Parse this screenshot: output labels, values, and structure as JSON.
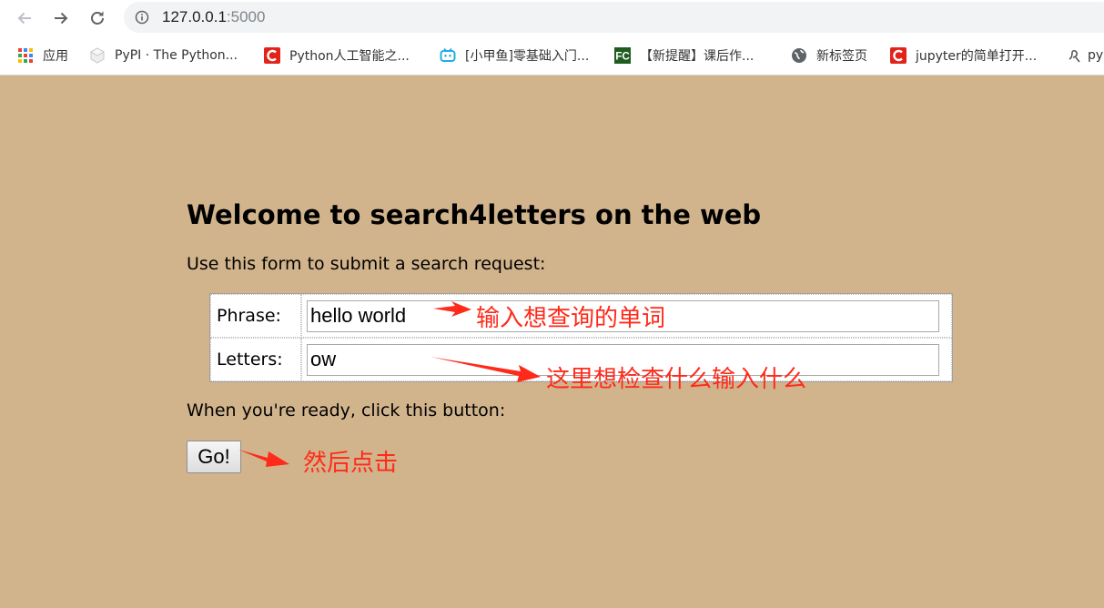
{
  "browser": {
    "url_host": "127.0.0.1",
    "url_port": ":5000",
    "bookmarks": [
      {
        "label": "应用",
        "icon": "apps-grid-icon"
      },
      {
        "label": "PyPI · The Python...",
        "icon": "pypi-icon"
      },
      {
        "label": "Python人工智能之...",
        "icon": "csdn-icon"
      },
      {
        "label": "[小甲鱼]零基础入门...",
        "icon": "bilibili-icon"
      },
      {
        "label": "【新提醒】课后作...",
        "icon": "fishc-icon",
        "icon_text": "FC"
      },
      {
        "label": "新标签页",
        "icon": "globe-icon"
      },
      {
        "label": "jupyter的简单打开...",
        "icon": "csdn-icon"
      },
      {
        "label": "py",
        "icon": "python-icon"
      }
    ]
  },
  "page": {
    "background": "#d2b48c",
    "title": "Welcome to search4letters on the web",
    "intro": "Use this form to submit a search request:",
    "phrase_label": "Phrase:",
    "phrase_value": "hello world",
    "letters_label": "Letters:",
    "letters_value": "ow",
    "ready_text": "When you're ready, click this button:",
    "go_button": "Go!"
  },
  "annotations": {
    "color": "#ff2a1a",
    "phrase_note": "输入想查询的单词",
    "letters_note": "这里想检查什么输入什么",
    "go_note": "然后点击"
  }
}
